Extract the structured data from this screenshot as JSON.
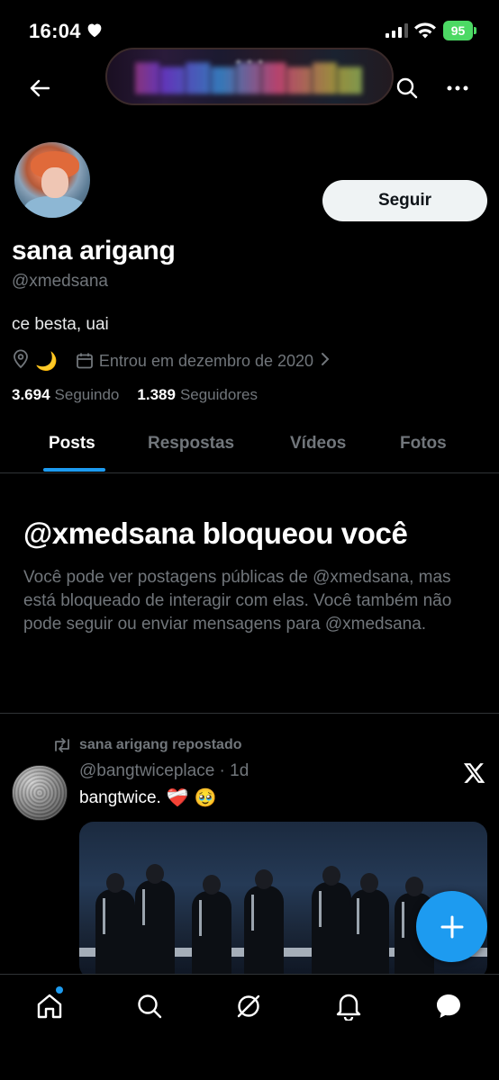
{
  "status_bar": {
    "time": "16:04",
    "battery": "95"
  },
  "profile": {
    "display_name": "sana arigang",
    "handle": "@xmedsana",
    "bio": "ce besta, uai",
    "location_emoji": "🌙",
    "joined": "Entrou em dezembro de 2020",
    "following_count": "3.694",
    "following_label": "Seguindo",
    "followers_count": "1.389",
    "followers_label": "Seguidores",
    "follow_button": "Seguir"
  },
  "tabs": [
    {
      "label": "Posts",
      "active": true
    },
    {
      "label": "Respostas",
      "active": false
    },
    {
      "label": "Vídeos",
      "active": false
    },
    {
      "label": "Fotos",
      "active": false
    }
  ],
  "blocked": {
    "title": "@xmedsana bloqueou você",
    "text": "Você pode ver postagens públicas de @xmedsana, mas está bloqueado de interagir com elas. Você também não pode seguir ou enviar mensagens para @xmedsana."
  },
  "post": {
    "repost_label": "sana arigang repostado",
    "author_handle": "@bangtwiceplace",
    "age": "1d",
    "text": "bangtwice.",
    "emojis": [
      "❤️‍🩹",
      "🥹"
    ]
  },
  "bottom_nav": {
    "items": [
      "home-icon",
      "search-icon",
      "grok-icon",
      "notifications-icon",
      "messages-icon"
    ]
  },
  "colors": {
    "accent": "#1d9bf0",
    "background": "#000000",
    "secondary_text": "#71767b",
    "primary_text": "#e7e9ea",
    "battery": "#4cd964"
  }
}
